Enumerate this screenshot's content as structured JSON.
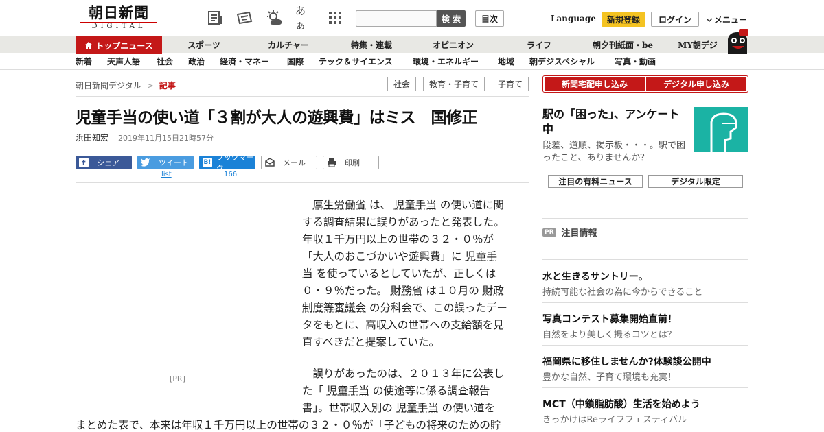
{
  "header": {
    "logo_main": "朝日新聞",
    "logo_sub": "DIGITAL",
    "search_button": "検 索",
    "toc": "目次",
    "language": "Language",
    "register": "新規登録",
    "login": "ログイン",
    "menu": "メニュー",
    "font_size_icon_text": "あぁ"
  },
  "nav_main": {
    "top_news": "トップニュース",
    "items": [
      "スポーツ",
      "カルチャー",
      "特集・連載",
      "オピニオン",
      "ライフ",
      "朝夕刊紙面・be",
      "MY朝デジ"
    ]
  },
  "nav_sub": {
    "items": [
      "新着",
      "天声人語",
      "社会",
      "政治",
      "経済・マネー",
      "国際",
      "テック＆サイエンス",
      "環境・エネルギー",
      "地域",
      "朝デジスペシャル",
      "写真・動画"
    ]
  },
  "breadcrumb": {
    "site": "朝日新聞デジタル",
    "separator": ">",
    "current": "記事"
  },
  "tags": [
    "社会",
    "教育・子育て",
    "子育て"
  ],
  "article": {
    "title": "児童手当の使い道「３割が大人の遊興費」はミス　国修正",
    "author": "浜田知宏",
    "date": "2019年11月15日21時57分",
    "pr_label": "[PR]",
    "p1_lines": [
      [
        {
          "t": "　"
        },
        {
          "t": "厚生労働省",
          "link": true
        },
        {
          "t": " は、 "
        },
        {
          "t": "児童手当",
          "link": true
        },
        {
          "t": " の使い道に関"
        }
      ],
      [
        {
          "t": "する調査結果に誤りがあったと発表した。"
        }
      ],
      [
        {
          "t": "年収１千万円以上の世帯の３２・０％が"
        }
      ],
      [
        {
          "t": "「大人のおこづかいや遊興費」に "
        },
        {
          "t": "児童手",
          "link": true
        }
      ],
      [
        {
          "t": "当",
          "link": true
        },
        {
          "t": " を使っているとしていたが、正しくは"
        }
      ],
      [
        {
          "t": "０・９％だった。 "
        },
        {
          "t": "財務省",
          "link": true
        },
        {
          "t": " は１０月の "
        },
        {
          "t": "財政",
          "link": true
        }
      ],
      [
        {
          "t": "制度等審議会",
          "link": true
        },
        {
          "t": " の分科会で、この誤ったデー"
        }
      ],
      [
        {
          "t": "タをもとに、高収入の世帯への支給額を見"
        }
      ],
      [
        {
          "t": "直すべきだと提案していた。"
        }
      ]
    ],
    "p2_lines": [
      [
        {
          "t": "　誤りがあったのは、２０１３年に公表し"
        }
      ],
      [
        {
          "t": "た「 "
        },
        {
          "t": "児童手当",
          "link": true
        },
        {
          "t": " の使途等に係る調査報告"
        }
      ],
      [
        {
          "t": "書」。世帯収入別の "
        },
        {
          "t": "児童手当",
          "link": true
        },
        {
          "t": " の使い道を"
        }
      ]
    ],
    "p2_full_line": "まとめた表で、本来は年収１千万円以上の世帯の３２・０％が「子どもの将来のための貯"
  },
  "share": {
    "facebook": "シェア",
    "twitter": "ツイート",
    "twitter_count": "list",
    "hatena": "ブックマーク",
    "hatena_icon": "B!",
    "hatena_count": "166",
    "mail": "メール",
    "print": "印刷"
  },
  "sidebar": {
    "order_home": "新聞宅配申し込み",
    "order_digital": "デジタル申し込み",
    "promo_title": "駅の「困った」、アンケート中",
    "promo_desc": "段差、道順、掲示板・・・。駅で困ったこと、ありませんか？",
    "tab_paid": "注目の有料ニュース",
    "tab_digital": "デジタル限定",
    "pr_badge": "PR",
    "pr_heading": "注目情報",
    "ads": [
      {
        "title": "水と生きるサントリー。",
        "desc": "持続可能な社会の為に今からできること"
      },
      {
        "title": "写真コンテスト募集開始直前！",
        "desc": "自然をより美しく撮るコツとは？"
      },
      {
        "title": "福岡県に移住しませんか?体験談公開中",
        "desc": "豊かな自然、子育て環境も充実！"
      },
      {
        "title": "MCT（中鎖脂肪酸）生活を始めよう",
        "desc": "きっかけはReライフフェスティバル"
      }
    ]
  },
  "colors": {
    "brand_red": "#c41818",
    "register_yellow": "#f4c322",
    "facebook": "#3b5998",
    "twitter": "#4a9ce0",
    "hatena": "#1b82d7",
    "promo_teal": "#1bb3a4"
  }
}
